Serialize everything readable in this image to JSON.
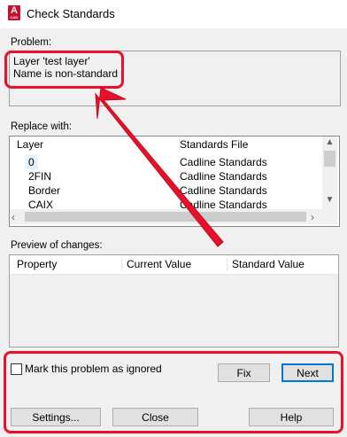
{
  "window": {
    "title": "Check Standards",
    "app_icon_letter": "A",
    "app_icon_caption": "CAD"
  },
  "problem": {
    "label": "Problem:",
    "line1": "Layer 'test layer'",
    "line2": "Name is non-standard"
  },
  "replace": {
    "label": "Replace with:",
    "columns": [
      "Layer",
      "Standards File"
    ],
    "rows": [
      {
        "layer": "0",
        "file": "Cadline Standards"
      },
      {
        "layer": "2FIN",
        "file": "Cadline Standards"
      },
      {
        "layer": "Border",
        "file": "Cadline Standards"
      },
      {
        "layer": "CAIX",
        "file": "Cadline Standards"
      }
    ]
  },
  "preview": {
    "label": "Preview of changes:",
    "columns": [
      "Property",
      "Current Value",
      "Standard Value"
    ]
  },
  "controls": {
    "ignore_label": "Mark this problem as ignored",
    "fix": "Fix",
    "next": "Next",
    "settings": "Settings...",
    "close": "Close",
    "help": "Help"
  },
  "annotation": {
    "highlight_color": "#e8102a"
  }
}
